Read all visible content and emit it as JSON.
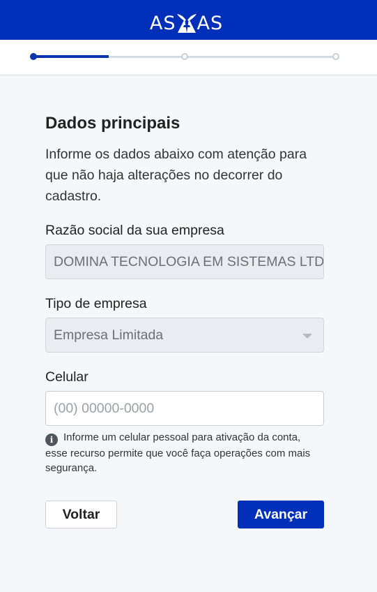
{
  "header": {
    "logo_left": "AS",
    "logo_right": "AS",
    "logo_icon": "wings-a-icon",
    "background_color": "#0030b9"
  },
  "stepper": {
    "total_steps": 3,
    "current_step": 1,
    "progress_fraction": 0.25
  },
  "form": {
    "title": "Dados principais",
    "description": "Informe os dados abaixo com atenção para que não haja alterações no decorrer do cadastro.",
    "company_name": {
      "label": "Razão social da sua empresa",
      "value": "DOMINA TECNOLOGIA EM SISTEMAS LTDA"
    },
    "company_type": {
      "label": "Tipo de empresa",
      "value": "Empresa Limitada"
    },
    "phone": {
      "label": "Celular",
      "placeholder": "(00) 00000-0000"
    },
    "hint": "Informe um celular pessoal para ativação da conta, esse recurso permite que você faça operações com mais segurança."
  },
  "actions": {
    "back_label": "Voltar",
    "next_label": "Avançar",
    "primary_color": "#0030b9"
  }
}
